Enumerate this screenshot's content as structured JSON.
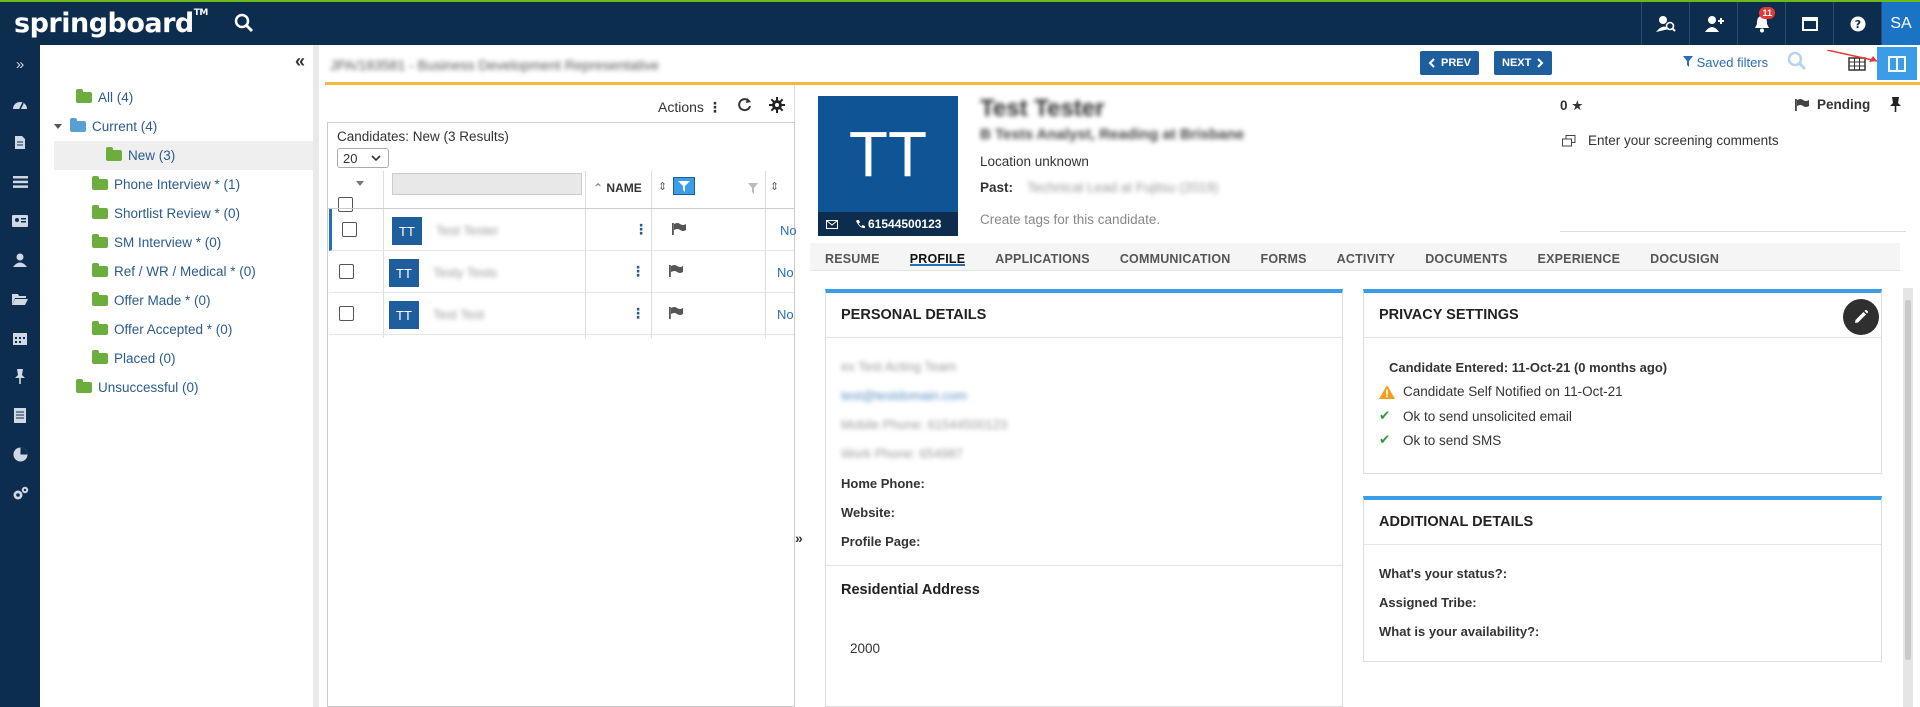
{
  "topbar": {
    "logo": "springboard",
    "logo_tm": "TM",
    "notification_count": "11",
    "avatar_initials": "SA"
  },
  "tree": {
    "items": [
      {
        "label": "All (4)"
      },
      {
        "label": "Current (4)"
      },
      {
        "label": "New (3)"
      },
      {
        "label": "Phone Interview * (1)"
      },
      {
        "label": "Shortlist Review * (0)"
      },
      {
        "label": "SM Interview * (0)"
      },
      {
        "label": "Ref / WR / Medical * (0)"
      },
      {
        "label": "Offer Made * (0)"
      },
      {
        "label": "Offer Accepted * (0)"
      },
      {
        "label": "Placed (0)"
      },
      {
        "label": "Unsuccessful (0)"
      }
    ]
  },
  "header": {
    "job_title": "JPA/183581 - Business Development Representative",
    "prev_label": "PREV",
    "next_label": "NEXT",
    "saved_filters": "Saved filters"
  },
  "list": {
    "actions_label": "Actions",
    "count_label": "Candidates: New (3 Results)",
    "page_size": "20",
    "col_name": "NAME",
    "rows": [
      {
        "initials": "TT",
        "name": "Test Tester",
        "status": "No"
      },
      {
        "initials": "TT",
        "name": "Testy Tests",
        "status": "No"
      },
      {
        "initials": "TT",
        "name": "Test Test",
        "status": "No"
      }
    ]
  },
  "profile": {
    "initials": "TT",
    "phone": "61544500123",
    "name": "Test Tester",
    "subtitle": "B Tests Analyst, Reading at Brisbane",
    "location": "Location unknown",
    "past_label": "Past:",
    "past_value": "Technical Lead at Fujitsu (2019)",
    "tags_placeholder": "Create tags for this candidate.",
    "rating": "0",
    "status": "Pending",
    "screening_placeholder": "Enter your screening comments",
    "tabs": [
      "RESUME",
      "PROFILE",
      "APPLICATIONS",
      "COMMUNICATION",
      "FORMS",
      "ACTIVITY",
      "DOCUMENTS",
      "EXPERIENCE",
      "DOCUSIGN"
    ]
  },
  "personal": {
    "title": "PERSONAL DETAILS",
    "blur_1": "ex Test Acting Team",
    "blur_2": "test@testdomain.com",
    "blur_3": "Mobile Phone: 61544500123",
    "blur_4": "Work Phone: 654987",
    "home_phone": "Home Phone:",
    "website": "Website:",
    "profile_page": "Profile Page:",
    "residential_title": "Residential Address",
    "postcode": "2000"
  },
  "privacy": {
    "title": "PRIVACY SETTINGS",
    "entered": "Candidate Entered: 11-Oct-21 (0 months ago)",
    "notified": "Candidate Self Notified on 11-Oct-21",
    "email_ok": "Ok to send unsolicited email",
    "sms_ok": "Ok to send SMS"
  },
  "additional": {
    "title": "ADDITIONAL DETAILS",
    "status_q": "What's your status?:",
    "tribe_q": "Assigned Tribe:",
    "availability_q": "What is your availability?:"
  },
  "colors": {
    "navy": "#0d2d4f",
    "accent_blue": "#3b9ce8",
    "link_blue": "#2a6fb4",
    "folder_green": "#6cae3e",
    "highlight_orange": "#f4b942"
  }
}
